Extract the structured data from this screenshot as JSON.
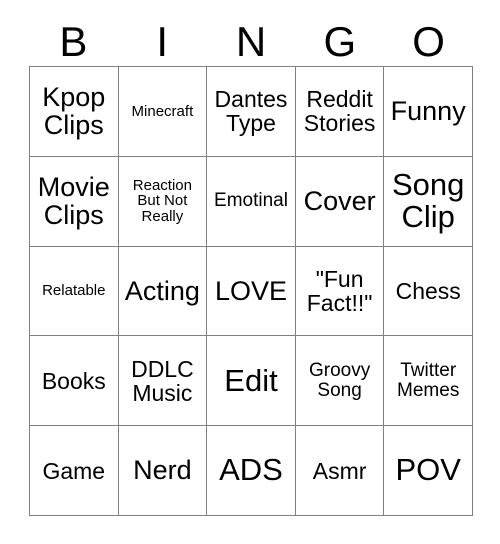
{
  "card": {
    "header_letters": [
      "B",
      "I",
      "N",
      "G",
      "O"
    ],
    "rows": [
      [
        {
          "text": "Kpop Clips",
          "size": "lg"
        },
        {
          "text": "Minecraft",
          "size": "xs"
        },
        {
          "text": "Dantes Type",
          "size": "md"
        },
        {
          "text": "Reddit Stories",
          "size": "md"
        },
        {
          "text": "Funny",
          "size": "lg"
        }
      ],
      [
        {
          "text": "Movie Clips",
          "size": "lg"
        },
        {
          "text": "Reaction But Not Really",
          "size": "xs"
        },
        {
          "text": "Emotinal",
          "size": "sm"
        },
        {
          "text": "Cover",
          "size": "lg"
        },
        {
          "text": "Song Clip",
          "size": "xl"
        }
      ],
      [
        {
          "text": "Relatable",
          "size": "xs"
        },
        {
          "text": "Acting",
          "size": "lg"
        },
        {
          "text": "LOVE",
          "size": "lg"
        },
        {
          "text": "\"Fun Fact!!\"",
          "size": "md"
        },
        {
          "text": "Chess",
          "size": "md"
        }
      ],
      [
        {
          "text": "Books",
          "size": "md"
        },
        {
          "text": "DDLC Music",
          "size": "md"
        },
        {
          "text": "Edit",
          "size": "xl"
        },
        {
          "text": "Groovy Song",
          "size": "sm"
        },
        {
          "text": "Twitter Memes",
          "size": "sm"
        }
      ],
      [
        {
          "text": "Game",
          "size": "md"
        },
        {
          "text": "Nerd",
          "size": "lg"
        },
        {
          "text": "ADS",
          "size": "xl"
        },
        {
          "text": "Asmr",
          "size": "md"
        },
        {
          "text": "POV",
          "size": "xl"
        }
      ]
    ]
  },
  "colors": {
    "text": "#000000",
    "grid_line": "#808080",
    "background": "#ffffff"
  }
}
